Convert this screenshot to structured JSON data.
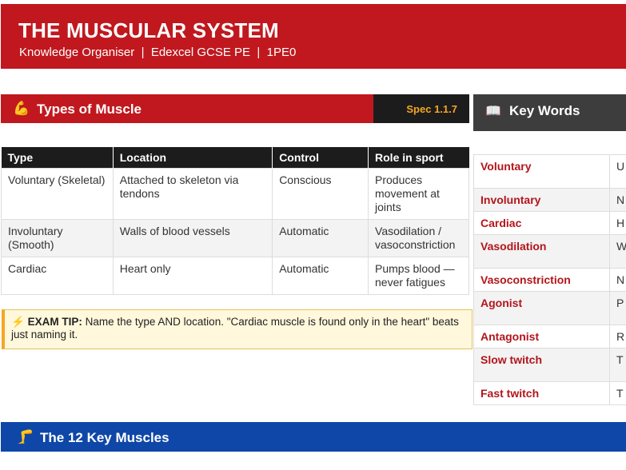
{
  "header": {
    "title": "THE MUSCULAR SYSTEM",
    "subtitle": "Knowledge Organiser  |  Edexcel GCSE PE  |  1PE0"
  },
  "types_section": {
    "icon": "💪",
    "title": "Types of Muscle",
    "spec": "Spec 1.1.7",
    "columns": [
      "Type",
      "Location",
      "Control",
      "Role in sport"
    ],
    "rows": [
      [
        "Voluntary (Skeletal)",
        "Attached to skeleton via tendons",
        "Conscious",
        "Produces movement at joints"
      ],
      [
        "Involuntary (Smooth)",
        "Walls of blood vessels",
        "Automatic",
        "Vasodilation / vasoconstriction"
      ],
      [
        "Cardiac",
        "Heart only",
        "Automatic",
        "Pumps blood — never fatigues"
      ]
    ]
  },
  "exam_tip": {
    "icon": "⚡",
    "label": "EXAM TIP:",
    "text": "Name the type AND location. \"Cardiac muscle is found only in the heart\" beats just naming it."
  },
  "key_words": {
    "icon": "📖",
    "title": "Key Words",
    "rows": [
      {
        "term": "Voluntary",
        "def": "U s"
      },
      {
        "term": "Involuntary",
        "def": "N"
      },
      {
        "term": "Cardiac",
        "def": "H"
      },
      {
        "term": "Vasodilation",
        "def": "W fl"
      },
      {
        "term": "Vasoconstriction",
        "def": "N"
      },
      {
        "term": "Agonist",
        "def": "P m"
      },
      {
        "term": "Antagonist",
        "def": "R"
      },
      {
        "term": "Slow twitch",
        "def": "T e"
      },
      {
        "term": "Fast twitch",
        "def": "T"
      }
    ]
  },
  "muscles_section": {
    "icon": "🦵",
    "title": "The 12 Key Muscles"
  }
}
